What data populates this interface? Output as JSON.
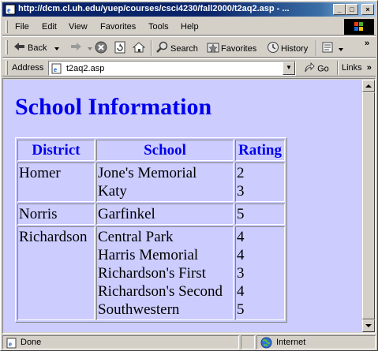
{
  "window": {
    "title": "http://dcm.cl.uh.edu/yuep/courses/csci4230/fall2000/t2aq2.asp - ...",
    "minimize": "_",
    "maximize": "□",
    "close": "×"
  },
  "menu": {
    "items": [
      "File",
      "Edit",
      "View",
      "Favorites",
      "Tools",
      "Help"
    ]
  },
  "toolbar": {
    "back_label": "Back",
    "search_label": "Search",
    "favorites_label": "Favorites",
    "history_label": "History"
  },
  "address": {
    "label": "Address",
    "value": "t2aq2.asp",
    "go_label": "Go",
    "links_label": "Links"
  },
  "page": {
    "title": "School Information",
    "table": {
      "headers": [
        "District",
        "School",
        "Rating"
      ],
      "rows": [
        {
          "district": "Homer",
          "schools": [
            "Jone's Memorial",
            "Katy"
          ],
          "ratings": [
            "2",
            "3"
          ]
        },
        {
          "district": "Norris",
          "schools": [
            "Garfinkel"
          ],
          "ratings": [
            "5"
          ]
        },
        {
          "district": "Richardson",
          "schools": [
            "Central Park",
            "Harris Memorial",
            "Richardson's First",
            "Richardson's Second",
            "Southwestern"
          ],
          "ratings": [
            "4",
            "4",
            "3",
            "4",
            "5"
          ]
        }
      ]
    }
  },
  "status": {
    "text": "Done",
    "zone": "Internet"
  },
  "colors": {
    "page_background": "#ccccff",
    "heading": "#0000ee",
    "titlebar": "#0a246a"
  }
}
